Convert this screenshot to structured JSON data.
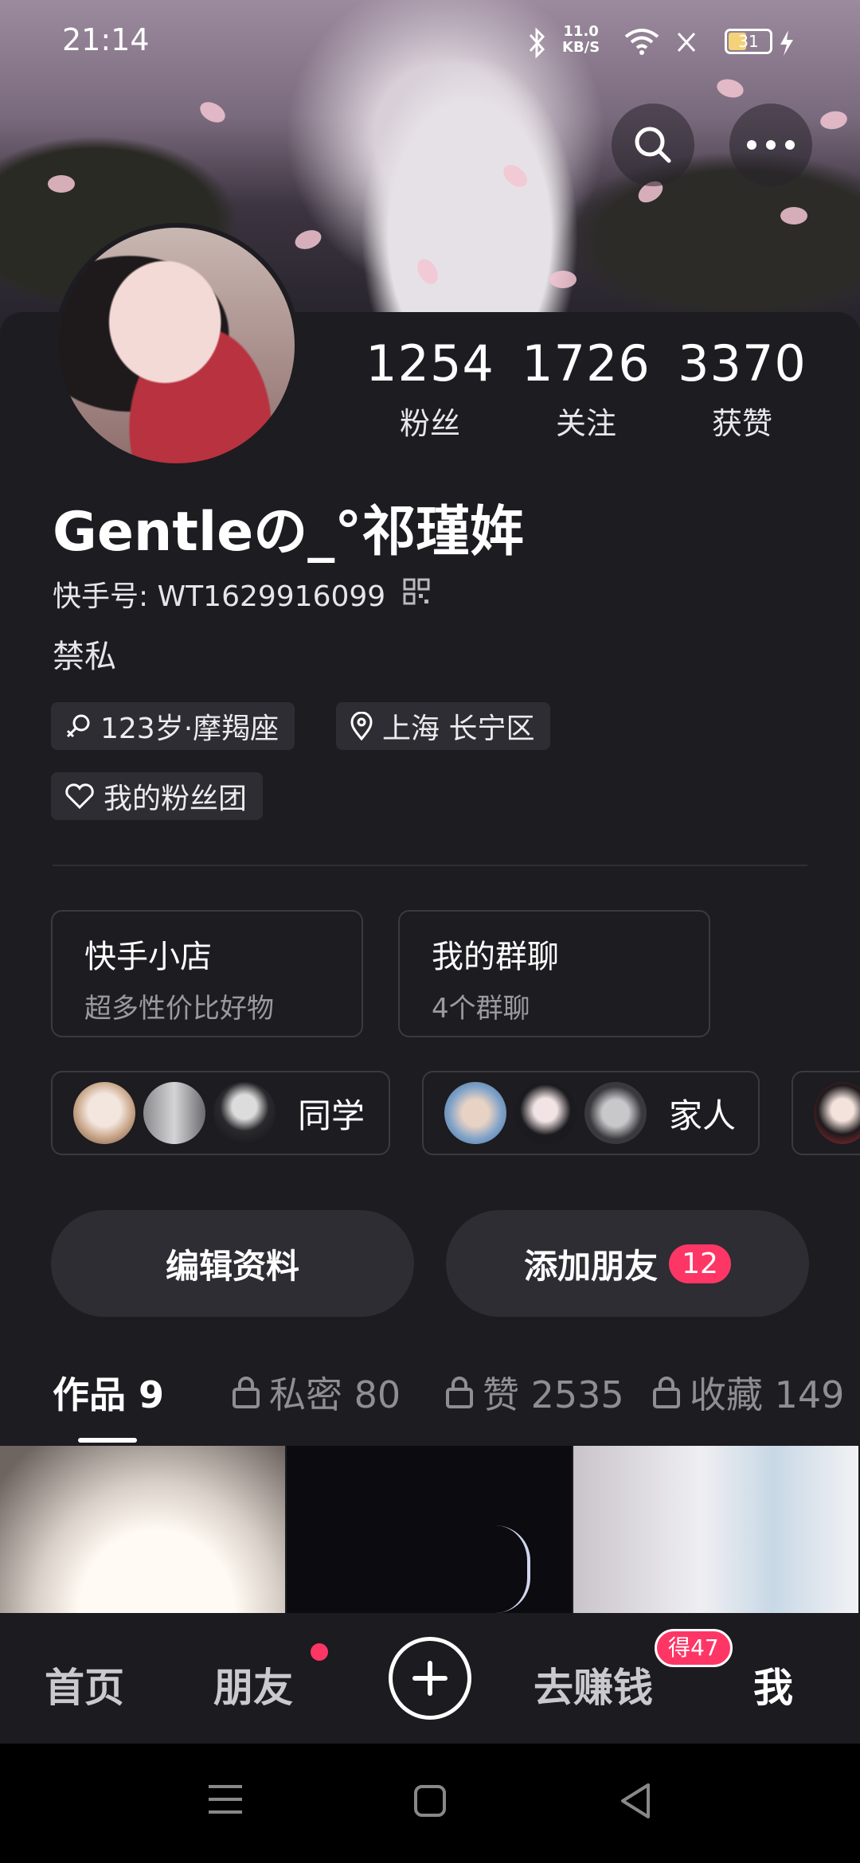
{
  "status_bar": {
    "time": "21:14",
    "net_speed": "11.0",
    "net_unit": "KB/S",
    "battery": "31"
  },
  "header": {
    "search_icon": "search-icon",
    "more_icon": "more-horizontal-icon"
  },
  "profile": {
    "stats": [
      {
        "value": "1254",
        "label": "粉丝"
      },
      {
        "value": "1726",
        "label": "关注"
      },
      {
        "value": "3370",
        "label": "获赞"
      }
    ],
    "name": "Gentleの_°祁瑾姩",
    "kuaishou_id": "快手号: WT1629916099",
    "bio": "禁私",
    "tags": [
      {
        "icon": "gender-icon",
        "text": "123岁·摩羯座"
      },
      {
        "icon": "location-icon",
        "text": "上海 长宁区"
      },
      {
        "icon": "heart-icon",
        "text": "我的粉丝团"
      }
    ]
  },
  "boxes": [
    {
      "title": "快手小店",
      "subtitle": "超多性价比好物"
    },
    {
      "title": "我的群聊",
      "subtitle": "4个群聊"
    }
  ],
  "groups": [
    {
      "label": "同学"
    },
    {
      "label": "家人"
    }
  ],
  "actions": {
    "edit": "编辑资料",
    "add_friend": "添加朋友",
    "add_friend_badge": "12"
  },
  "tabs": [
    {
      "label": "作品 9",
      "locked": false
    },
    {
      "label": "私密 80",
      "locked": true
    },
    {
      "label": "赞 2535",
      "locked": true
    },
    {
      "label": "收藏 149",
      "locked": true
    }
  ],
  "bottom_nav": {
    "home": "首页",
    "friends": "朋友",
    "earn": "去赚钱",
    "earn_badge": "得47",
    "me": "我"
  },
  "colors": {
    "background": "#1c1c21",
    "accent": "#fe3666",
    "chip": "#2d2d33"
  }
}
